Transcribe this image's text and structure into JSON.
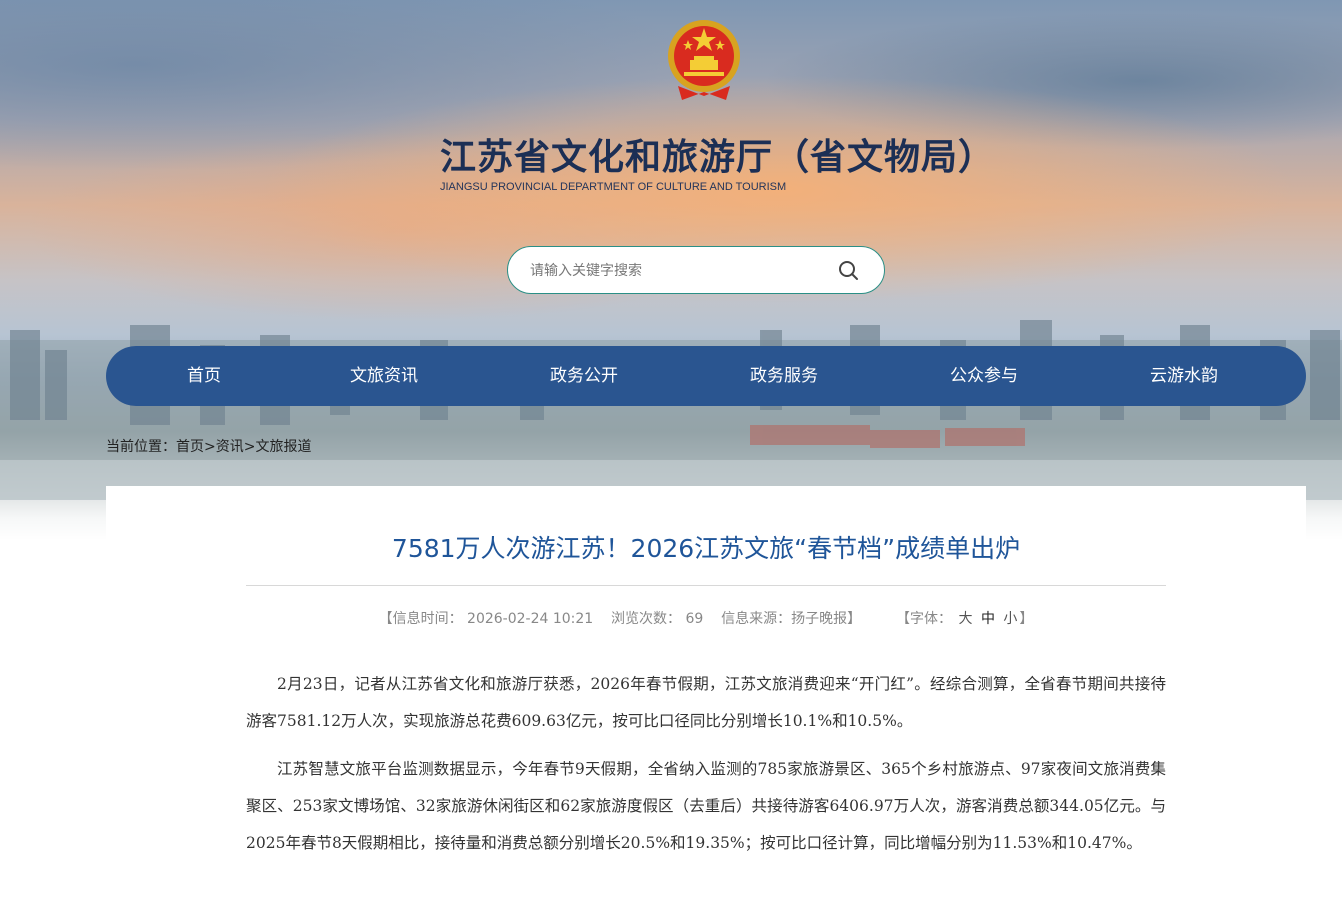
{
  "header": {
    "title": "江苏省文化和旅游厅（省文物局）",
    "subtitle": "JIANGSU PROVINCIAL DEPARTMENT OF CULTURE AND TOURISM",
    "emblem_icon": "national-emblem-icon"
  },
  "search": {
    "placeholder": "请输入关键字搜索",
    "value": "",
    "button_icon": "search-icon"
  },
  "nav": {
    "items": [
      {
        "label": "首页"
      },
      {
        "label": "文旅资讯"
      },
      {
        "label": "政务公开"
      },
      {
        "label": "政务服务"
      },
      {
        "label": "公众参与"
      },
      {
        "label": "云游水韵"
      }
    ]
  },
  "breadcrumb": {
    "prefix": "当前位置：",
    "items": [
      "首页",
      "资讯",
      "文旅报道"
    ],
    "separator": ">"
  },
  "article": {
    "title": "7581万人次游江苏！2026江苏文旅“春节档”成绩单出炉",
    "meta": {
      "time_label": "【信息时间：",
      "time_value": "2026-02-24 10:21",
      "views_label": "浏览次数：",
      "views_value": "69",
      "source_label": "信息来源：",
      "source_value": "扬子晚报",
      "source_close": "】",
      "font_label": "【字体：",
      "font_large": "大",
      "font_medium": "中",
      "font_small": "小",
      "font_close": "】"
    },
    "paragraphs": [
      "2月23日，记者从江苏省文化和旅游厅获悉，2026年春节假期，江苏文旅消费迎来“开门红”。经综合测算，全省春节期间共接待游客7581.12万人次，实现旅游总花费609.63亿元，按可比口径同比分别增长10.1%和10.5%。",
      "江苏智慧文旅平台监测数据显示，今年春节9天假期，全省纳入监测的785家旅游景区、365个乡村旅游点、97家夜间文旅消费集聚区、253家文博场馆、32家旅游休闲街区和62家旅游度假区（去重后）共接待游客6406.97万人次，游客消费总额344.05亿元。与2025年春节8天假期相比，接待量和消费总额分别增长20.5%和19.35%；按可比口径计算，同比增幅分别为11.53%和10.47%。"
    ]
  },
  "colors": {
    "nav_bg": "#2a5590",
    "title_blue": "#1f5599",
    "header_title": "#1c2f55",
    "search_border": "#2a8f86"
  }
}
